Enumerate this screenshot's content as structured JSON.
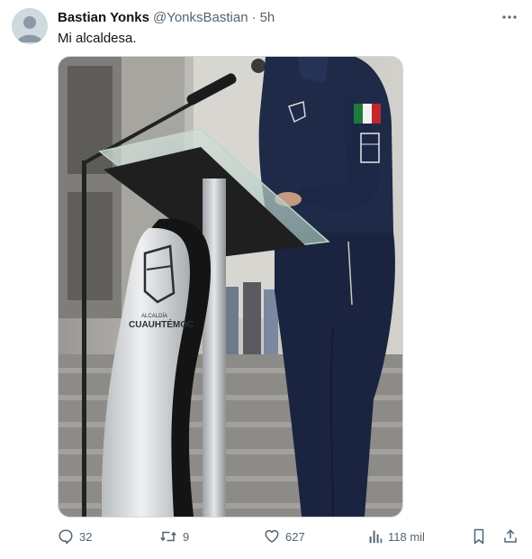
{
  "tweet": {
    "author_name": "Bastian Yonks",
    "handle": "@YonksBastian",
    "separator": "·",
    "time": "5h",
    "text": "Mi alcaldesa.",
    "more_icon": "more-horizontal-icon"
  },
  "media": {
    "podium_emblem_text": "CUAUHTÉMOC",
    "podium_caption": "ALCALDÍA"
  },
  "actions": {
    "replies": "32",
    "retweets": "9",
    "likes": "627",
    "views": "118 mil",
    "icons": [
      "reply-icon",
      "retweet-icon",
      "like-icon",
      "views-icon",
      "bookmark-icon",
      "share-icon"
    ]
  },
  "colors": {
    "text_primary": "#0f1419",
    "text_secondary": "#536471",
    "border": "#cfd9de",
    "uniform_navy": "#1e2a4a"
  }
}
